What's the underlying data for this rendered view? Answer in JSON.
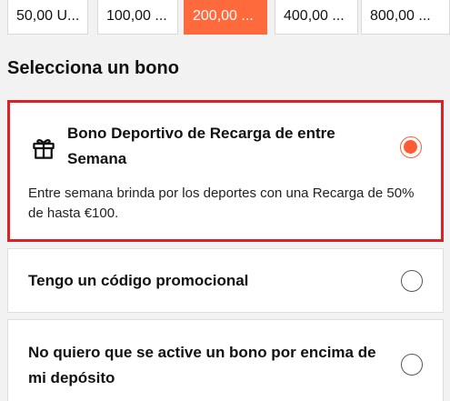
{
  "amounts": [
    {
      "label": "50,00 U...",
      "selected": false
    },
    {
      "label": "100,00 ...",
      "selected": false
    },
    {
      "label": "200,00 ...",
      "selected": true
    },
    {
      "label": "400,00 ...",
      "selected": false
    },
    {
      "label": "800,00 ...",
      "selected": false
    }
  ],
  "bonus_section": {
    "title": "Selecciona un bono",
    "options": [
      {
        "title": "Bono Deportivo de Recarga de entre Semana",
        "description": "Entre semana brinda por los deportes con una Recarga de 50% de hasta €100.",
        "icon": "gift-icon",
        "selected": true
      },
      {
        "title": "Tengo un código promocional",
        "selected": false
      },
      {
        "title": "No quiero que se active un bono por encima de mi depósito",
        "selected": false
      }
    ]
  },
  "colors": {
    "accent": "#ff6a3d",
    "selected_border": "#d8222a"
  }
}
